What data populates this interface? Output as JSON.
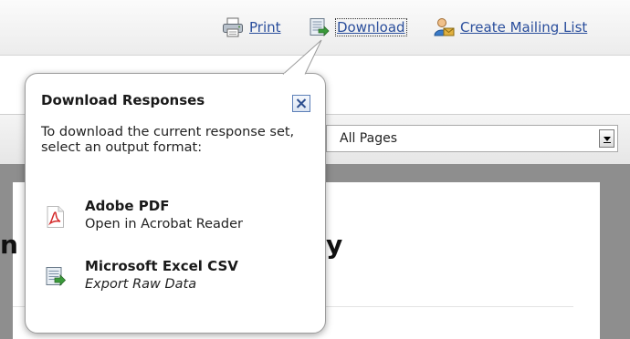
{
  "toolbar": {
    "print_label": "Print",
    "download_label": "Download",
    "mailing_label": "Create Mailing List"
  },
  "filter": {
    "page_select_value": "All Pages"
  },
  "background": {
    "heading_fragment_left": "n",
    "heading_fragment_right": "y"
  },
  "popup": {
    "title": "Download Responses",
    "description": "To download the current response set, select an output format:",
    "options": [
      {
        "title": "Adobe PDF",
        "subtitle": "Open in Acrobat Reader",
        "icon": "pdf-icon"
      },
      {
        "title": "Microsoft Excel CSV",
        "subtitle": "Export Raw Data",
        "icon": "excel-icon"
      }
    ],
    "close_icon": "close-icon"
  },
  "colors": {
    "link": "#2a4e9c",
    "pdf_red": "#d42a2a",
    "excel_green": "#3a9a3a"
  }
}
